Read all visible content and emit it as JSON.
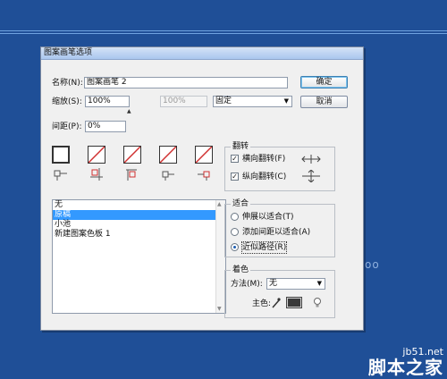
{
  "dialog": {
    "title": "图案画笔选项",
    "name_label": "名称(N):",
    "name_value": "图案画笔 2",
    "scale_label": "缩放(S):",
    "scale_value": "100%",
    "scale_disabled_value": "100%",
    "scale_mode": "固定",
    "spacing_label": "间距(P):",
    "spacing_value": "0%",
    "ok_label": "确定",
    "cancel_label": "取消"
  },
  "pattern_list": {
    "items": [
      "无",
      "原稿",
      "小池",
      "新建图案色板 1"
    ],
    "selected_index": 1
  },
  "flip": {
    "title": "翻转",
    "horizontal_label": "横向翻转(F)",
    "horizontal_checked": true,
    "vertical_label": "纵向翻转(C)",
    "vertical_checked": true
  },
  "fit": {
    "title": "适合",
    "options": [
      "伸展以适合(T)",
      "添加间距以适合(A)",
      "近似路径(R)"
    ],
    "selected_index": 2
  },
  "colorize": {
    "title": "着色",
    "method_label": "方法(M):",
    "method_value": "无",
    "key_color_label": "主色:",
    "key_color": "#3a3a3a"
  },
  "background": {
    "partial_text": "oo",
    "color": "#1f4f97"
  },
  "watermark": {
    "site": "jb51.net",
    "name": "脚本之家"
  }
}
